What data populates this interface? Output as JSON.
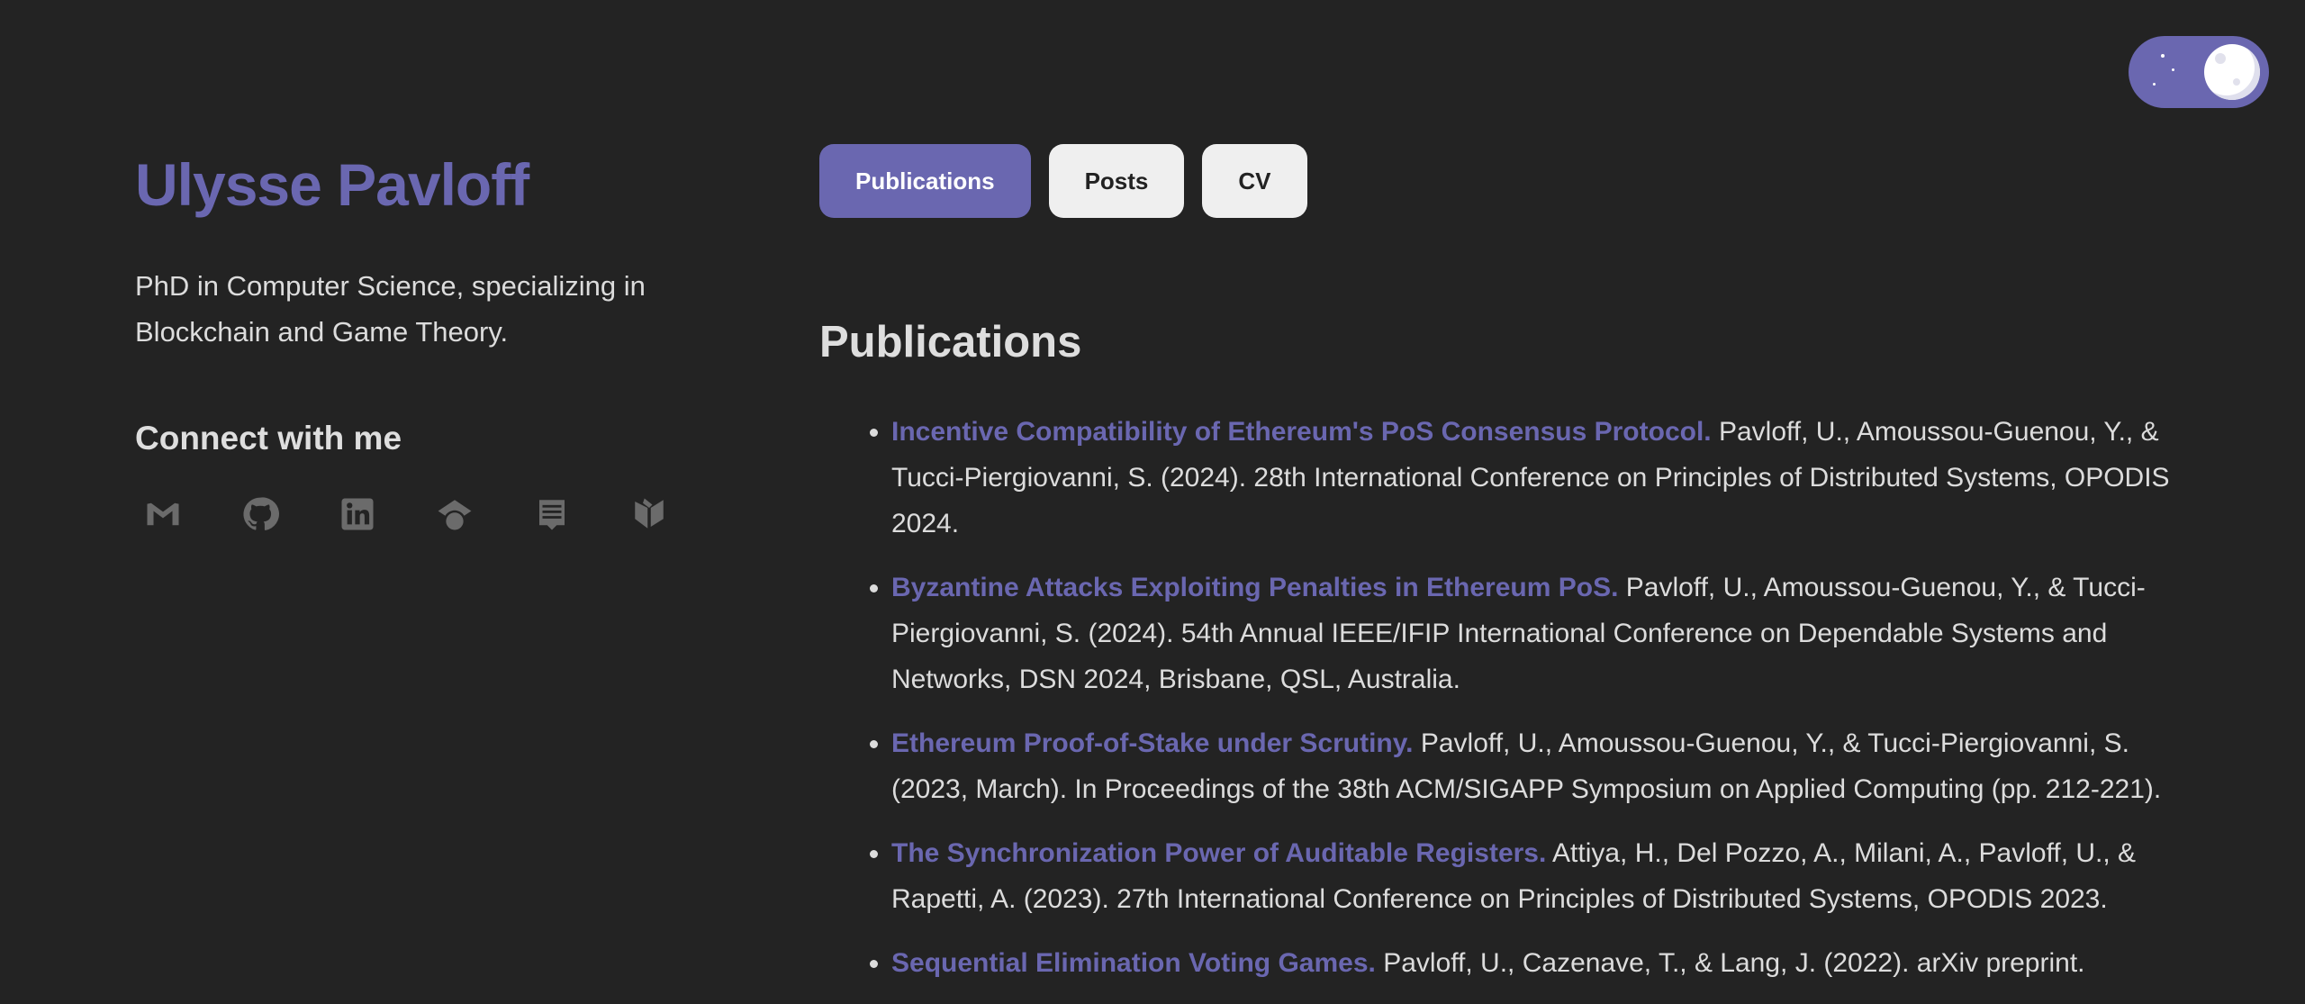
{
  "profile": {
    "name": "Ulysse Pavloff",
    "bio": "PhD in Computer Science, specializing in Blockchain and Game Theory.",
    "connect_heading": "Connect with me"
  },
  "social_icons": [
    "gmail-icon",
    "github-icon",
    "linkedin-icon",
    "google-scholar-icon",
    "orcid-icon",
    "dblp-icon"
  ],
  "nav": {
    "publications": "Publications",
    "posts": "Posts",
    "cv": "CV",
    "active": "Publications"
  },
  "main": {
    "section_title": "Publications",
    "publications": [
      {
        "title": "Incentive Compatibility of Ethereum's PoS Consensus Protocol.",
        "details": " Pavloff, U., Amoussou-Guenou, Y., & Tucci-Piergiovanni, S. (2024). 28th International Conference on Principles of Distributed Systems, OPODIS 2024."
      },
      {
        "title": "Byzantine Attacks Exploiting Penalties in Ethereum PoS.",
        "details": " Pavloff, U., Amoussou-Guenou, Y., & Tucci-Piergiovanni, S. (2024). 54th Annual IEEE/IFIP International Conference on Dependable Systems and Networks, DSN 2024, Brisbane, QSL, Australia."
      },
      {
        "title": "Ethereum Proof-of-Stake under Scrutiny.",
        "details": " Pavloff, U., Amoussou-Guenou, Y., & Tucci-Piergiovanni, S. (2023, March). In Proceedings of the 38th ACM/SIGAPP Symposium on Applied Computing (pp. 212-221)."
      },
      {
        "title": "The Synchronization Power of Auditable Registers.",
        "details": " Attiya, H., Del Pozzo, A., Milani, A., Pavloff, U., & Rapetti, A. (2023). 27th International Conference on Principles of Distributed Systems, OPODIS 2023."
      },
      {
        "title": "Sequential Elimination Voting Games.",
        "details": " Pavloff, U., Cazenave, T., & Lang, J. (2022). arXiv preprint."
      }
    ]
  },
  "colors": {
    "background": "#232323",
    "accent": "#6a67b0",
    "text": "#dcdcdc",
    "icon": "#6b6b6b",
    "button_inactive": "#efefef"
  }
}
